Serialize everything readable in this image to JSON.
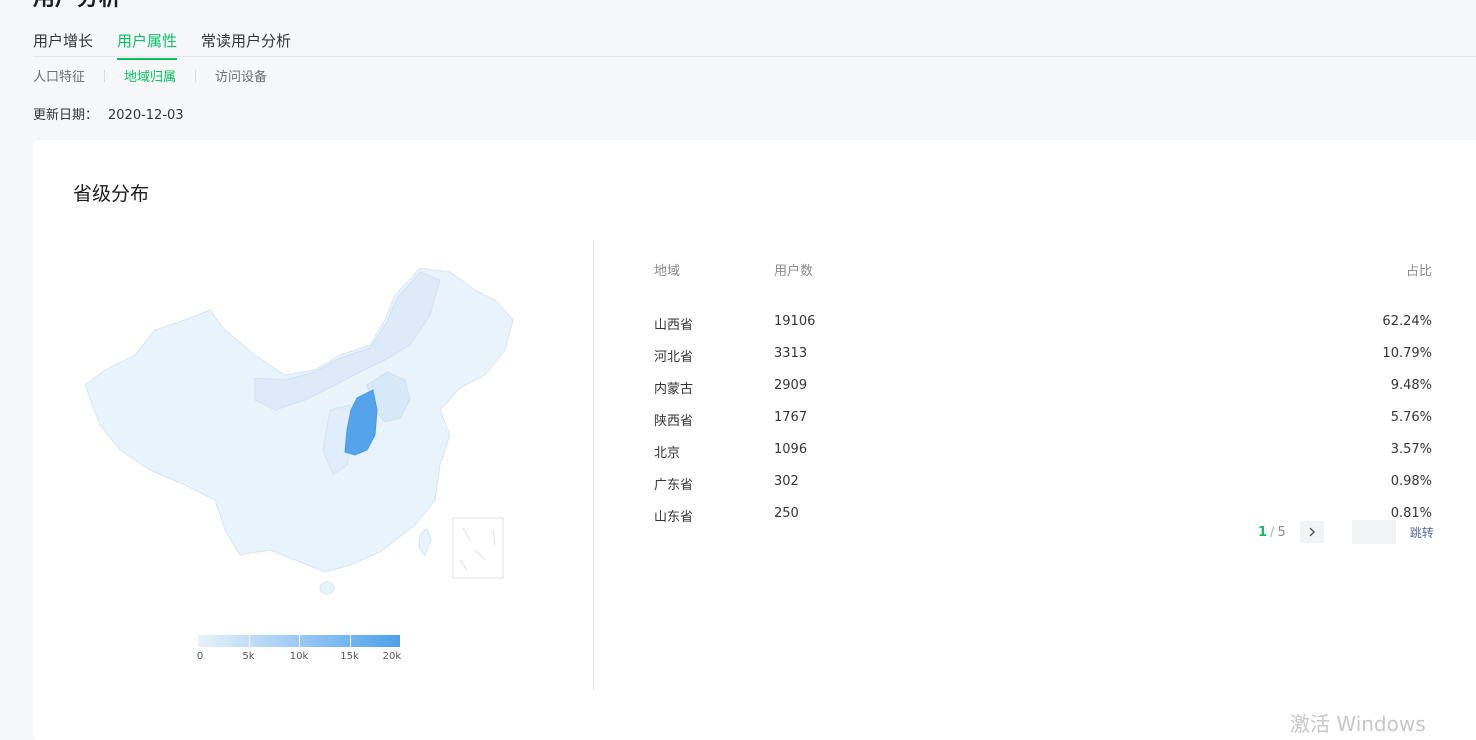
{
  "page_title": "用户分析",
  "tabs": [
    {
      "label": "用户增长"
    },
    {
      "label": "用户属性"
    },
    {
      "label": "常读用户分析"
    }
  ],
  "subtabs": [
    {
      "label": "人口特征"
    },
    {
      "label": "地域归属"
    },
    {
      "label": "访问设备"
    }
  ],
  "update": {
    "label": "更新日期：",
    "value": "2020-12-03"
  },
  "card": {
    "title": "省级分布"
  },
  "legend": {
    "ticks": [
      "0",
      "5k",
      "10k",
      "15k",
      "20k"
    ],
    "colors": {
      "low": "#e8f2fc",
      "high": "#4da0ea"
    }
  },
  "table": {
    "headers": {
      "region": "地域",
      "users": "用户数",
      "share": "占比"
    },
    "rows": [
      {
        "region": "山西省",
        "users": "19106",
        "share": "62.24%"
      },
      {
        "region": "河北省",
        "users": "3313",
        "share": "10.79%"
      },
      {
        "region": "内蒙古",
        "users": "2909",
        "share": "9.48%"
      },
      {
        "region": "陕西省",
        "users": "1767",
        "share": "5.76%"
      },
      {
        "region": "北京",
        "users": "1096",
        "share": "3.57%"
      },
      {
        "region": "广东省",
        "users": "302",
        "share": "0.98%"
      },
      {
        "region": "山东省",
        "users": "250",
        "share": "0.81%"
      }
    ]
  },
  "pager": {
    "current": "1",
    "slash": "/",
    "total": "5",
    "next_icon": "chevron-right-icon",
    "jump_label": "跳转"
  },
  "watermark": "激活 Windows",
  "accent_color": "#07c160"
}
